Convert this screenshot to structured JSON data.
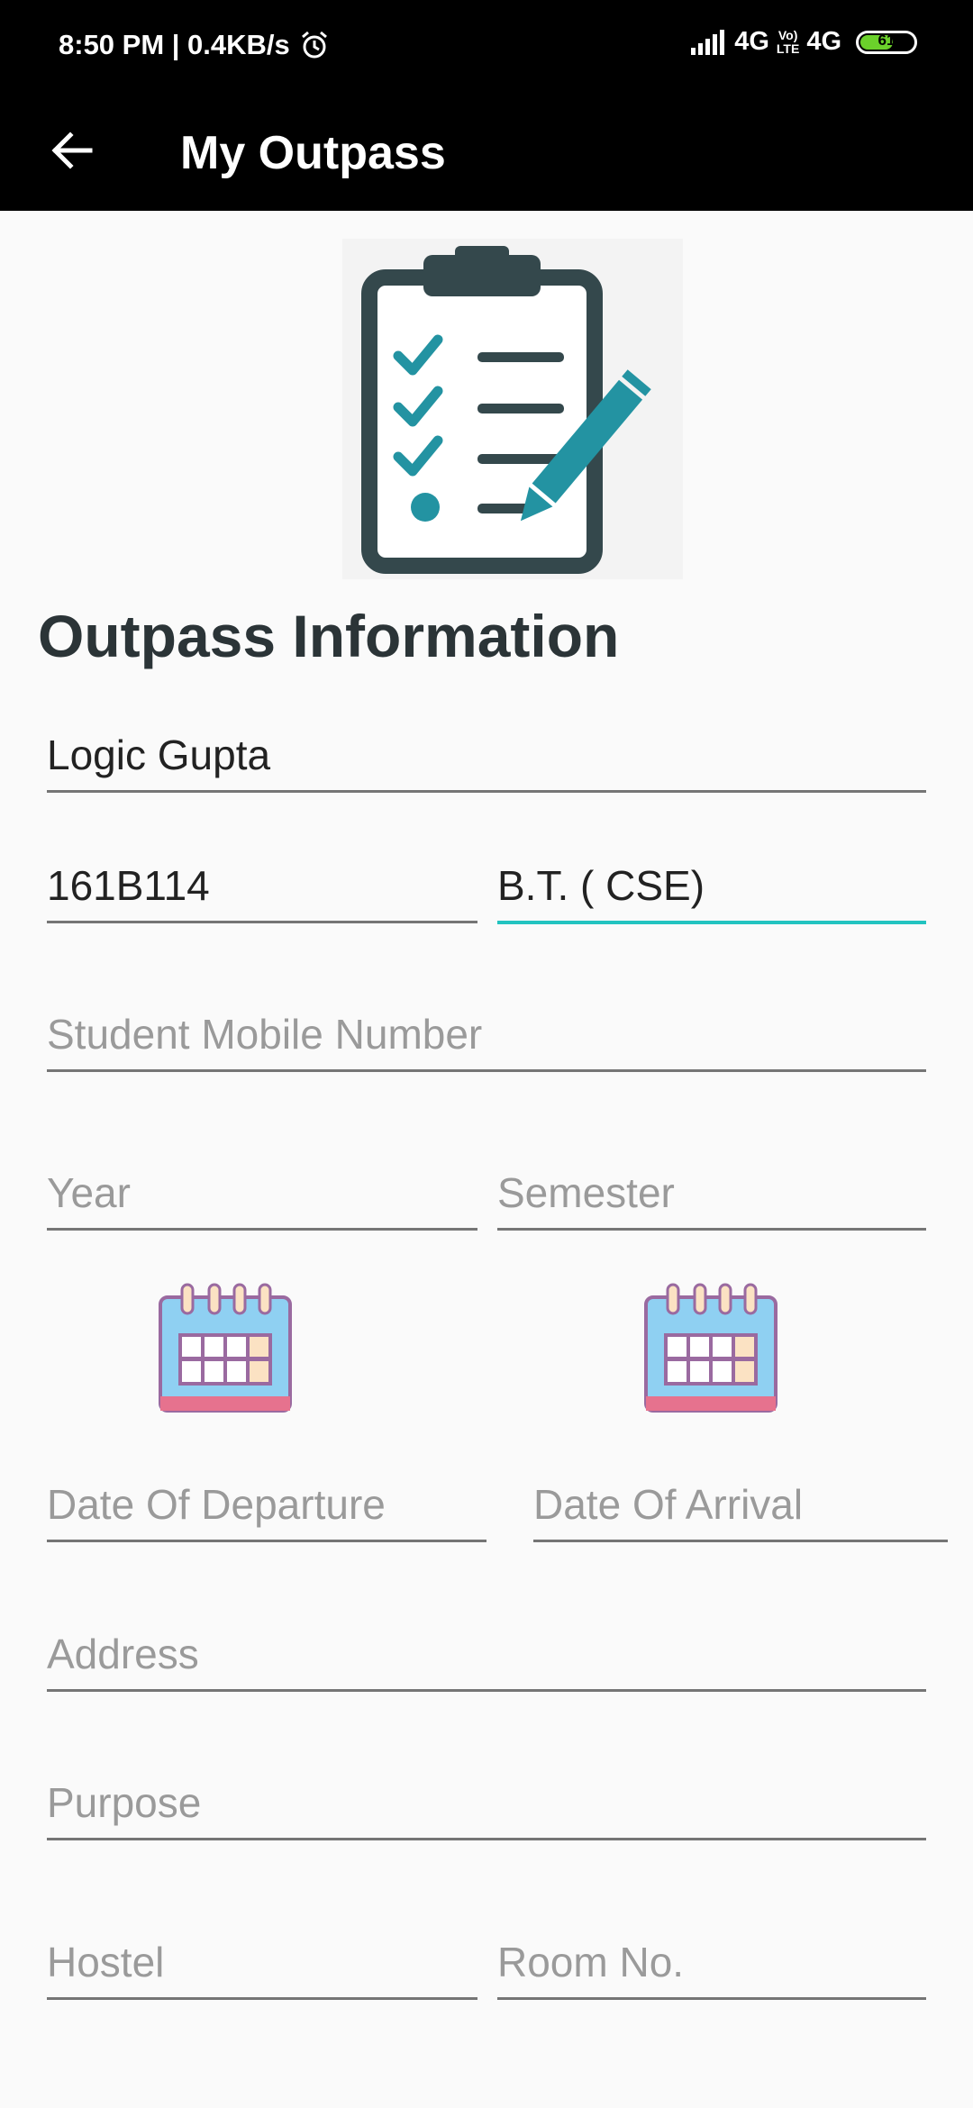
{
  "status_bar": {
    "time_speed": "8:50 PM | 0.4KB/s",
    "network1": "4G",
    "volte_top": "Vo)",
    "volte_bottom": "LTE",
    "network2": "4G",
    "battery": "61"
  },
  "app_bar": {
    "title": "My Outpass"
  },
  "form": {
    "heading": "Outpass Information",
    "name_value": "Logic Gupta",
    "roll_value": "161B114",
    "course_value": "B.T. ( CSE)",
    "mobile_placeholder": "Student Mobile Number",
    "year_placeholder": "Year",
    "semester_placeholder": "Semester",
    "departure_placeholder": "Date Of Departure",
    "arrival_placeholder": "Date Of Arrival",
    "address_placeholder": "Address",
    "purpose_placeholder": "Purpose",
    "hostel_placeholder": "Hostel",
    "room_placeholder": "Room No."
  },
  "icons": {
    "back": "arrow-left-icon",
    "hero": "clipboard-checklist-icon",
    "calendar": "calendar-icon",
    "alarm": "alarm-clock-icon"
  },
  "colors": {
    "accent": "#22c3c0",
    "appbar": "#000000",
    "heading": "#2b3437",
    "underline": "#757575",
    "placeholder": "#9a9a9a"
  }
}
